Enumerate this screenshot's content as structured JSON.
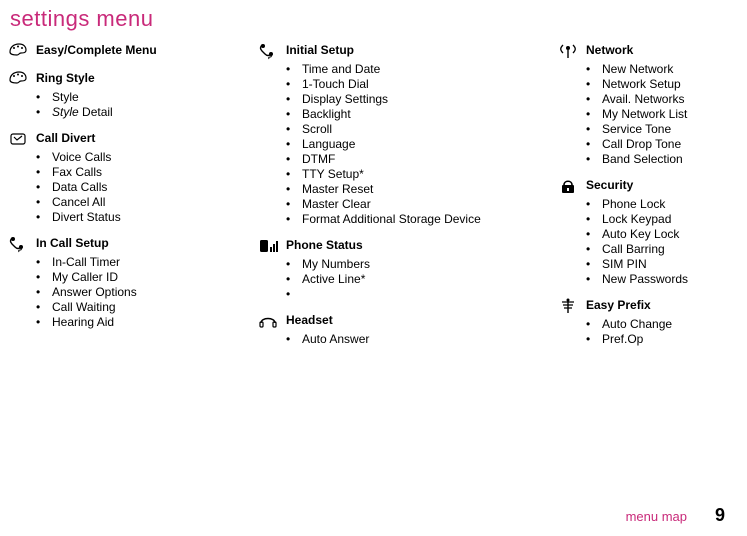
{
  "title": "settings menu",
  "footer": {
    "text": "menu map",
    "page": "9"
  },
  "columns": [
    [
      {
        "icon": "palette-icon",
        "title": "Easy/Complete Menu",
        "items": []
      },
      {
        "icon": "palette-icon",
        "title": "Ring Style",
        "items": [
          {
            "text": "Style"
          },
          {
            "text": "Style Detail",
            "styleHtml": "<span class='italic'>Style</span> Detail"
          }
        ]
      },
      {
        "icon": "phone-hand-icon",
        "title": "Call Divert",
        "items": [
          {
            "text": "Voice Calls"
          },
          {
            "text": "Fax Calls"
          },
          {
            "text": "Data Calls"
          },
          {
            "text": "Cancel All"
          },
          {
            "text": "Divert Status"
          }
        ]
      },
      {
        "icon": "handset-cord-icon",
        "title": "In Call Setup",
        "items": [
          {
            "text": "In-Call Timer"
          },
          {
            "text": "My Caller ID"
          },
          {
            "text": "Answer Options"
          },
          {
            "text": "Call Waiting"
          },
          {
            "text": "Hearing Aid"
          }
        ]
      }
    ],
    [
      {
        "icon": "handset-cord-icon",
        "title": "Initial Setup",
        "items": [
          {
            "text": "Time and Date"
          },
          {
            "text": "1-Touch Dial"
          },
          {
            "text": "Display Settings"
          },
          {
            "text": "Backlight"
          },
          {
            "text": "Scroll"
          },
          {
            "text": "Language"
          },
          {
            "text": "DTMF"
          },
          {
            "text": "TTY Setup*"
          },
          {
            "text": "Master Reset"
          },
          {
            "text": "Master Clear"
          },
          {
            "text": "Format Additional Storage Device"
          }
        ]
      },
      {
        "icon": "phone-bars-icon",
        "title": "Phone Status",
        "items": [
          {
            "text": "My Numbers"
          },
          {
            "text": "Active Line*"
          },
          {
            "text": "",
            "empty": true
          }
        ]
      },
      {
        "icon": "headset-icon",
        "title": "Headset",
        "items": [
          {
            "text": "Auto Answer"
          }
        ]
      }
    ],
    [
      {
        "icon": "antenna-icon",
        "title": "Network",
        "items": [
          {
            "text": "New Network"
          },
          {
            "text": "Network Setup"
          },
          {
            "text": "Avail. Networks"
          },
          {
            "text": "My Network List"
          },
          {
            "text": "Service Tone"
          },
          {
            "text": "Call Drop Tone"
          },
          {
            "text": "Band Selection"
          }
        ]
      },
      {
        "icon": "lock-icon",
        "title": "Security",
        "items": [
          {
            "text": "Phone Lock"
          },
          {
            "text": "Lock Keypad"
          },
          {
            "text": "Auto Key Lock"
          },
          {
            "text": "Call Barring"
          },
          {
            "text": "SIM PIN"
          },
          {
            "text": "New Passwords"
          }
        ]
      },
      {
        "icon": "antenna2-icon",
        "title": "Easy Prefix",
        "items": [
          {
            "text": "Auto Change"
          },
          {
            "text": "Pref.Op"
          }
        ]
      }
    ]
  ]
}
